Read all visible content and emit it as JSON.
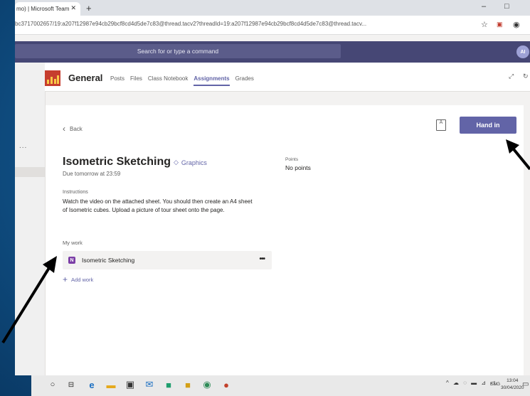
{
  "browser": {
    "tab_title": "mo) | Microsoft Team",
    "tab_close": "✕",
    "new_tab": "+",
    "minimize": "–",
    "maximize": "□",
    "url": "bc3717002657/19:a207f12987e94cb29bcf8cd4d5de7c83@thread.tacv2?threadId=19:a207f12987e94cb29bcf8cd4d5de7c83@thread.tacv..."
  },
  "teams": {
    "search_placeholder": "Search for or type a command",
    "avatar_initials": "AI"
  },
  "channel": {
    "name": "General",
    "tabs": [
      {
        "label": "Posts"
      },
      {
        "label": "Files"
      },
      {
        "label": "Class Notebook"
      },
      {
        "label": "Assignments"
      },
      {
        "label": "Grades"
      }
    ],
    "rail_dots": "..."
  },
  "assignment": {
    "back_label": "Back",
    "hand_in_label": "Hand in",
    "title": "Isometric Sketching",
    "category": "Graphics",
    "due": "Due tomorrow at 23:59",
    "points_label": "Points",
    "points_value": "No points",
    "instructions_label": "Instructions",
    "instructions_text": "Watch the video on the attached sheet. You should then create an A4 sheet of Isometric cubes. Upload a picture of tour sheet onto the page.",
    "my_work_label": "My work",
    "work_item_name": "Isometric Sketching",
    "work_item_icon": "N",
    "work_item_more": "•••",
    "add_work_label": "Add work",
    "add_work_plus": "+"
  },
  "taskbar": {
    "language": "ENG",
    "time": "13:04",
    "date": "30/04/2020"
  },
  "colors": {
    "teams_purple": "#6264a7",
    "teams_header": "#464775",
    "background_blue": "#11578f"
  }
}
